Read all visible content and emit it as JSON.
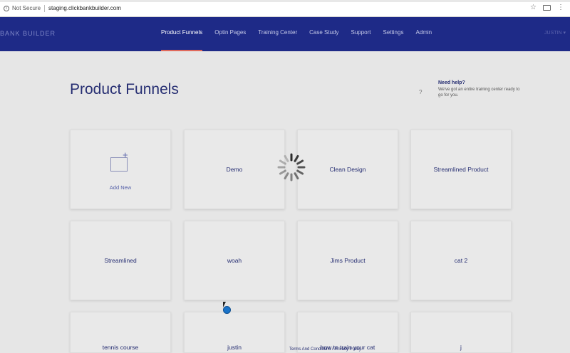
{
  "browser": {
    "secure_label": "Not Secure",
    "url": "staging.clickbankbuilder.com"
  },
  "nav": {
    "brand": "BANK BUILDER",
    "items": [
      {
        "label": "Product Funnels",
        "active": true
      },
      {
        "label": "Optin Pages"
      },
      {
        "label": "Training Center"
      },
      {
        "label": "Case Study"
      },
      {
        "label": "Support"
      },
      {
        "label": "Settings"
      },
      {
        "label": "Admin"
      }
    ],
    "user": "JUSTIN"
  },
  "page": {
    "title": "Product Funnels",
    "help_icon": "?",
    "help_heading": "Need help?",
    "help_text": "We've got an entire training center ready to go for you."
  },
  "cards": {
    "add_label": "Add New",
    "items": [
      "Demo",
      "Clean Design",
      "Streamlined Product",
      "Streamlined",
      "woah",
      "Jims Product",
      "cat 2",
      "tennis course",
      "justin",
      "how to train your cat",
      "j"
    ]
  },
  "footer": {
    "terms": "Terms And Conditions / Privacy Policy"
  },
  "colors": {
    "nav_bg": "#1e2a87",
    "accent": "#e06a5c",
    "page_bg": "#e6e6e6",
    "text": "#262e72"
  }
}
